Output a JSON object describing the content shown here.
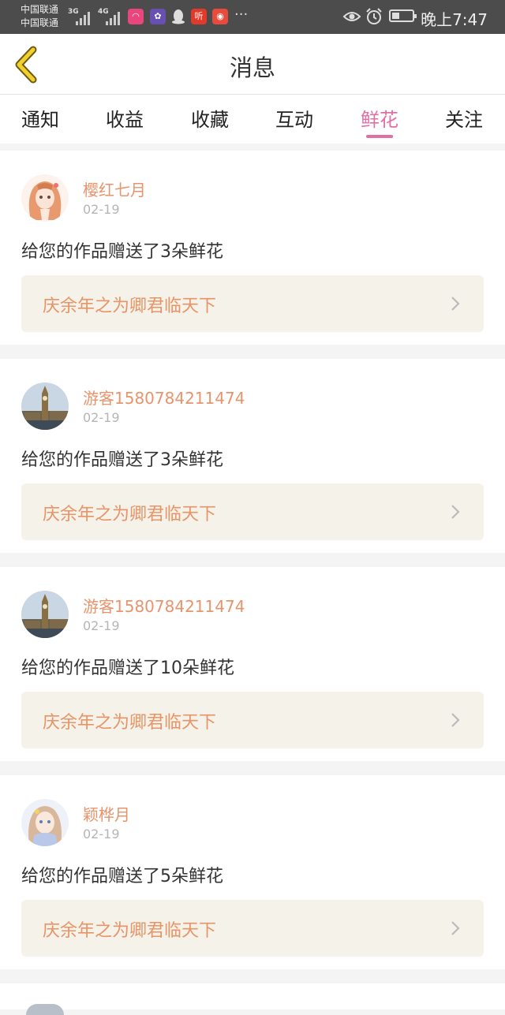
{
  "status_bar": {
    "carrier_1": "中国联通",
    "carrier_2": "中国联通",
    "net_1": "3G",
    "net_2": "4G",
    "apps": [
      {
        "icon": "red-chat-app-icon",
        "glyph": "◠"
      },
      {
        "icon": "purple-app-icon",
        "glyph": "✿"
      },
      {
        "icon": "qq-penguin-icon",
        "glyph": ""
      },
      {
        "icon": "listen-app-icon",
        "glyph": "听"
      },
      {
        "icon": "red-pig-app-icon",
        "glyph": "◉"
      }
    ],
    "more": "···",
    "time": "晚上7:47"
  },
  "header": {
    "title": "消息",
    "back_color": "#e6c200"
  },
  "tabs": [
    {
      "label": "通知"
    },
    {
      "label": "收益"
    },
    {
      "label": "收藏"
    },
    {
      "label": "互动"
    },
    {
      "label": "鲜花"
    },
    {
      "label": "关注"
    }
  ],
  "active_tab": "鲜花",
  "accent_color": "#e06fa3",
  "messages": [
    {
      "user": "樱红七月",
      "date": "02-19",
      "text": "给您的作品赠送了3朵鲜花",
      "work": "庆余年之为卿君临天下",
      "avatar": "anime-girl-avatar"
    },
    {
      "user": "游客1580784211474",
      "date": "02-19",
      "text": "给您的作品赠送了3朵鲜花",
      "work": "庆余年之为卿君临天下",
      "avatar": "big-ben-avatar"
    },
    {
      "user": "游客1580784211474",
      "date": "02-19",
      "text": "给您的作品赠送了10朵鲜花",
      "work": "庆余年之为卿君临天下",
      "avatar": "big-ben-avatar"
    },
    {
      "user": "颖桦月",
      "date": "02-19",
      "text": "给您的作品赠送了5朵鲜花",
      "work": "庆余年之为卿君临天下",
      "avatar": "anime-girl-avatar"
    }
  ]
}
